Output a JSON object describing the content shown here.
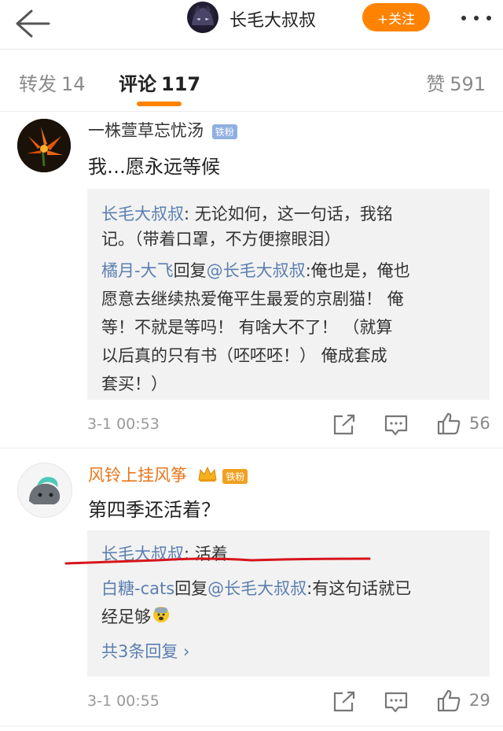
{
  "header": {
    "title": "长毛大叔叔",
    "follow_label": "+关注"
  },
  "tabs": [
    {
      "label": "转发",
      "count": "14"
    },
    {
      "label": "评论",
      "count": "117"
    },
    {
      "label": "赞",
      "count": "591"
    }
  ],
  "comments": [
    {
      "user": "一株萱草忘忧汤",
      "badge": "铁粉",
      "text": "我…愿永远等候",
      "replies": [
        {
          "author": "长毛大叔叔",
          "sep": ": ",
          "lines": [
            "无论如何，这一句话，我铭",
            "记。（带着口罩，不方便擦眼泪）"
          ]
        },
        {
          "author": "橘月-大飞",
          "mid": "回复",
          "mention": "@长毛大叔叔",
          "sep": ":",
          "lines": [
            "俺也是，俺也",
            "愿意去继续热爱俺平生最爱的京剧猫！ 俺",
            "等！不就是等吗！   有啥大不了！  （就算",
            "以后真的只有书（呸呸呸！）    俺成套成",
            "套买！）"
          ]
        }
      ],
      "time": "3-1 00:53",
      "likes": "56"
    },
    {
      "user": "风铃上挂风筝",
      "badge": "铁粉",
      "text": "第四季还活着？",
      "replies": [
        {
          "author": "长毛大叔叔",
          "sep": ": ",
          "lines": [
            "活着"
          ]
        },
        {
          "author": "白糖-cats",
          "mid": "回复",
          "mention": "@长毛大叔叔",
          "sep": ":",
          "lines": [
            "有这句话就已",
            "经足够"
          ]
        }
      ],
      "more_replies": "共3条回复 ›",
      "time": "3-1 00:55",
      "likes": "29"
    }
  ],
  "colors": {
    "accent": "#ff8200",
    "link": "#5b7fb0",
    "badge": "#8fb0e0",
    "vip_name": "#e8761c"
  }
}
